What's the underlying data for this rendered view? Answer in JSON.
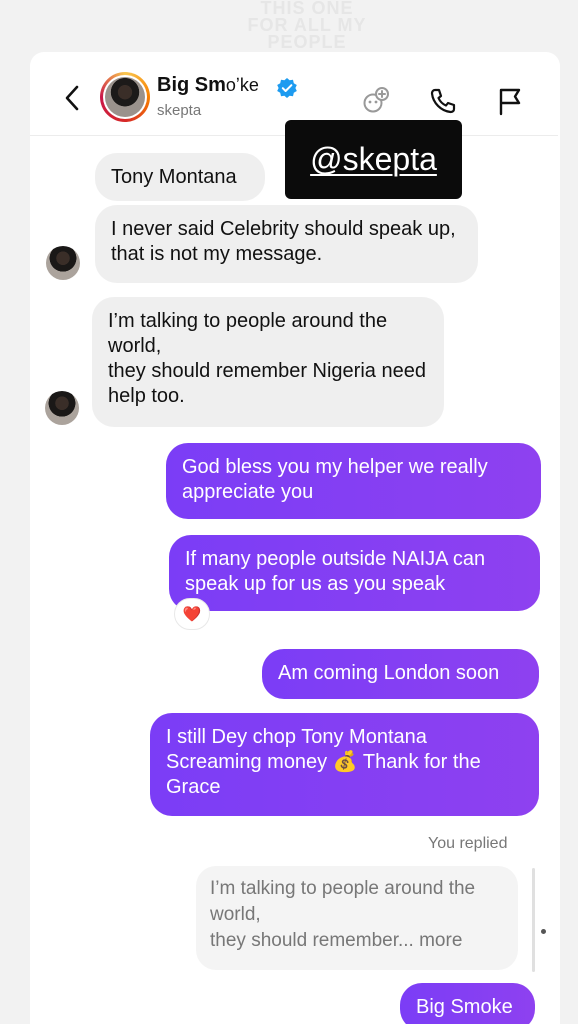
{
  "overlay": {
    "lines": [
      "THIS ONE",
      "FOR ALL MY",
      "PEOPLE"
    ]
  },
  "header": {
    "name": "Big Sm",
    "name_tail": "oʼke",
    "handle": "skepta"
  },
  "sticker": {
    "text": "@skepta"
  },
  "messages": {
    "m1": "Tony Montana",
    "m2": "I never said Celebrity should speak up, that is not my message.",
    "m3_line1": "I’m talking to people around the world,",
    "m3_line2": "they should remember Nigeria need help too.",
    "m4": "God bless you my helper we really appreciate you",
    "m5": "If many people outside NAIJA can speak up for us as you speak",
    "m6": "Am coming London soon",
    "m7_a": "I still Dey chop Tony Montana Screaming money ",
    "m7_emoji": "💰",
    "m7_b": " Thank for the Grace",
    "reaction": "❤️",
    "you_replied": "You replied",
    "quote_line1": "I’m talking to people around the world,",
    "quote_line2": "they should remember... more",
    "m8": "Big Smoke"
  },
  "icons": [
    "back-icon",
    "verified-icon",
    "effects-icon",
    "phone-icon",
    "flag-icon"
  ],
  "colors": {
    "outgoing": "#7b3df6",
    "incoming": "#efefef",
    "verified": "#1d9bf0"
  }
}
